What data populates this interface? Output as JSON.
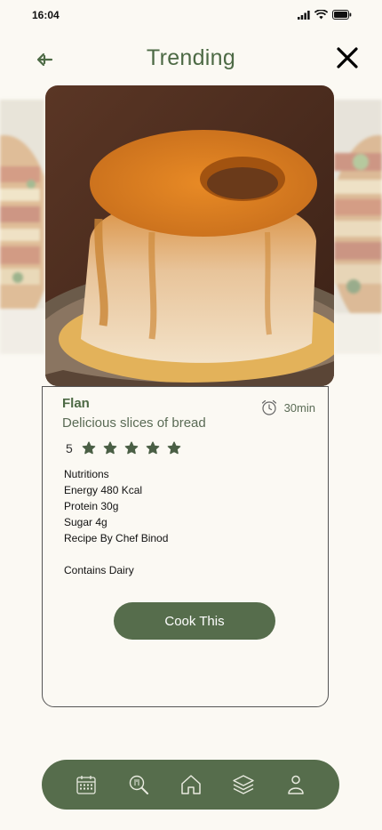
{
  "status_bar": {
    "time": "16:04"
  },
  "header": {
    "title": "Trending"
  },
  "recipe": {
    "name": "Flan",
    "subtitle": "Delicious slices of bread",
    "time": "30min",
    "rating": "5",
    "stars": 5,
    "nutrition": [
      "Nutritions",
      "Energy 480 Kcal",
      "Protein 30g",
      "Sugar 4g",
      "Recipe By Chef Binod"
    ],
    "note": "Contains Dairy",
    "cta_label": "Cook This"
  },
  "colors": {
    "accent": "#566d4c",
    "title": "#4d6a45",
    "background": "#fbf9f3"
  },
  "nav_icons": [
    "calendar-icon",
    "search-recipe-icon",
    "home-icon",
    "layers-icon",
    "profile-icon"
  ]
}
